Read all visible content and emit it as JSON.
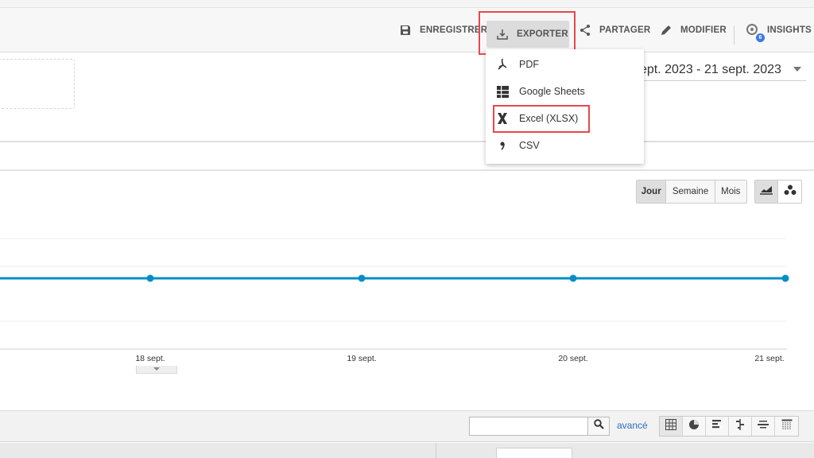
{
  "toolbar": {
    "save_label": "ENREGISTRER",
    "export_label": "EXPORTER",
    "share_label": "PARTAGER",
    "edit_label": "MODIFIER",
    "insights_label": "INSIGHTS",
    "insights_badge": "6"
  },
  "date_range": {
    "value": "ept. 2023 - 21 sept. 2023"
  },
  "export_menu": {
    "items": [
      {
        "label": "PDF",
        "icon": "pdf-icon"
      },
      {
        "label": "Google Sheets",
        "icon": "google-sheets-icon"
      },
      {
        "label": "Excel (XLSX)",
        "icon": "excel-icon"
      },
      {
        "label": "CSV",
        "icon": "csv-icon"
      }
    ]
  },
  "period": {
    "options": [
      "Jour",
      "Semaine",
      "Mois"
    ],
    "selected": "Jour"
  },
  "chart_data": {
    "type": "line",
    "categories": [
      "18 sept.",
      "19 sept.",
      "20 sept.",
      "21 sept."
    ],
    "series": [
      {
        "values": [
          0,
          0,
          0,
          0
        ]
      }
    ],
    "color": "#058dc7",
    "grid": true
  },
  "table_tools": {
    "search_placeholder": "",
    "advanced_label": "avancé"
  },
  "colors": {
    "line": "#058dc7",
    "highlight": "#e8474c",
    "link": "#2a6dbf"
  }
}
